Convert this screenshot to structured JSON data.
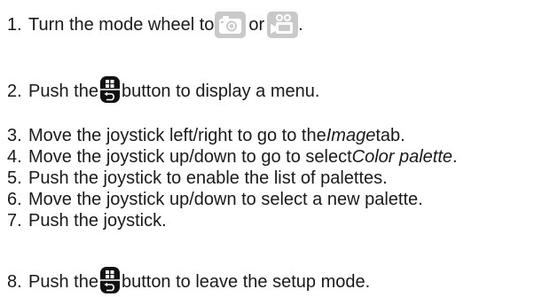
{
  "steps": [
    {
      "num": "1.",
      "parts": [
        "Turn the mode wheel to ",
        " or ",
        "."
      ]
    },
    {
      "num": "2.",
      "parts": [
        "Push the ",
        " button to display a menu."
      ]
    },
    {
      "num": "3.",
      "parts": [
        "Move the joystick left/right to go to the ",
        "Image",
        " tab."
      ]
    },
    {
      "num": "4.",
      "parts": [
        "Move the joystick up/down to go to select ",
        "Color palette",
        "."
      ]
    },
    {
      "num": "5.",
      "text": "Push the joystick to enable the list of palettes."
    },
    {
      "num": "6.",
      "text": "Move the joystick up/down to select a new palette."
    },
    {
      "num": "7.",
      "text": "Push the joystick."
    },
    {
      "num": "8.",
      "parts": [
        "Push the ",
        " button to leave the setup mode."
      ]
    }
  ],
  "icons": {
    "camera_mode": "camera-icon",
    "video_mode": "video-camera-icon",
    "menu_back_button": "menu-back-button-icon"
  },
  "colors": {
    "icon_bg": "#cfcfcf",
    "icon_fg": "#ffffff",
    "button_bg": "#111111",
    "text": "#1a1a1a"
  }
}
